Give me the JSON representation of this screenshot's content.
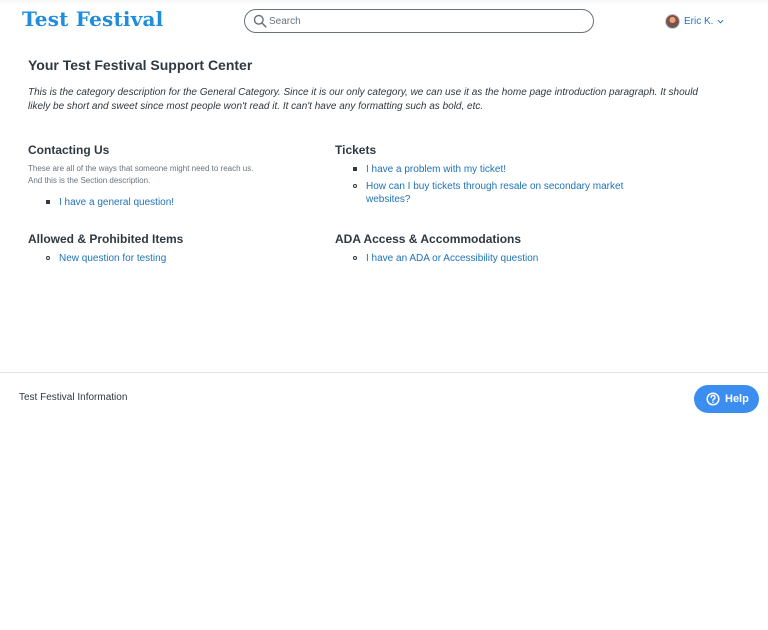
{
  "header": {
    "logo_text": "Test Festival",
    "search_placeholder": "Search",
    "user_name": "Eric K."
  },
  "main": {
    "title": "Your Test Festival Support Center",
    "intro": "This is the category description for the General Category. Since it is our only category, we can use it as the home page introduction paragraph. It should likely be short and sweet since most people won't read it. It can't have any formatting such as bold, etc.",
    "sections": [
      {
        "title": "Contacting Us",
        "description_lines": [
          "These are all of the ways that someone might need to reach us.",
          "And this is the Section description."
        ],
        "articles": [
          "I have a general question!"
        ]
      },
      {
        "title": "Tickets",
        "articles": [
          "I have a problem with my ticket!",
          "How can I buy tickets through resale on secondary market websites?"
        ]
      },
      {
        "title": "Allowed & Prohibited Items",
        "articles": [
          "New question for testing"
        ]
      },
      {
        "title": "ADA Access & Accommodations",
        "articles": [
          "I have an ADA or Accessibility question"
        ]
      }
    ]
  },
  "footer": {
    "text": "Test Festival Information",
    "help_label": "Help"
  },
  "colors": {
    "brand": "#1f8ddb",
    "link": "#1f73b7",
    "help_button": "#3b8ef0"
  }
}
